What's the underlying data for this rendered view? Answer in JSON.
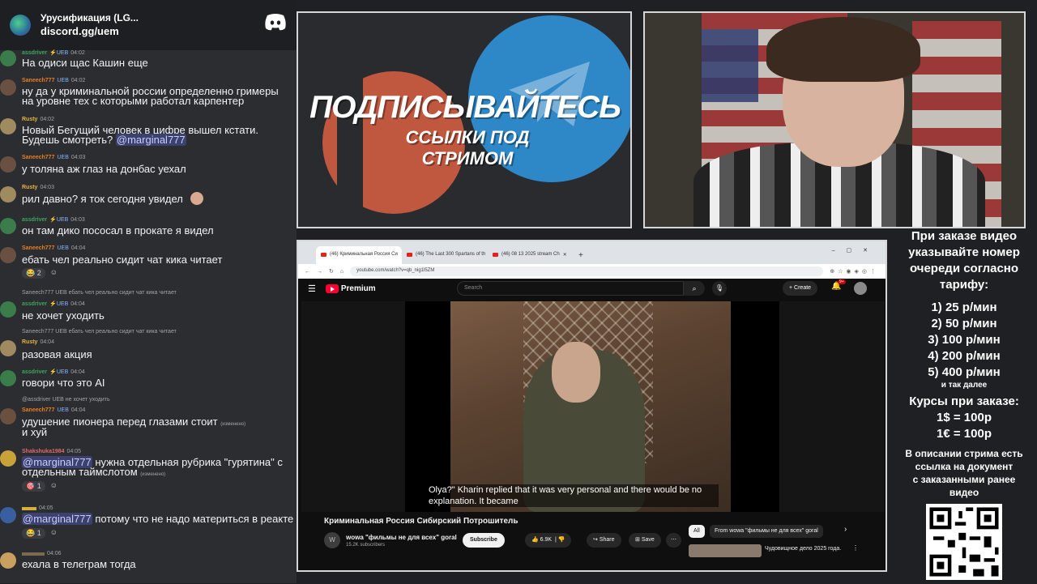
{
  "discord": {
    "server_title": "Урусификация (LG...",
    "server_link": "discord.gg/uem"
  },
  "messages": [
    {
      "user": "assdriver",
      "badge": "⚡UEB",
      "time": "04:02",
      "text": "На одиси щас Кашин еще"
    },
    {
      "user": "Saneech777",
      "badge": "UEB",
      "time": "04:02",
      "text": "ну да у криминальной россии определенно гримеры",
      "text2": "на уровне тех с которыми работал карпентер"
    },
    {
      "user": "Rusty",
      "badge": "",
      "time": "04:02",
      "text": "Новый Бегущий человек в цифре вышел кстати.",
      "text2": "Будешь смотреть?",
      "mention": "@marginal777"
    },
    {
      "user": "Saneech777",
      "badge": "UEB",
      "time": "04:03",
      "text": "у толяна аж глаз на донбас уехал"
    },
    {
      "user": "Rusty",
      "badge": "",
      "time": "04:03",
      "text": "рил давно? я ток сегодня увидел"
    },
    {
      "user": "assdriver",
      "badge": "⚡UEB",
      "time": "04:03",
      "text": "он там дико пососал в прокате я видел"
    },
    {
      "user": "Saneech777",
      "badge": "UEB",
      "time": "04:04",
      "text": "ебать чел реально сидит чат кика читает",
      "reaction": "2"
    },
    {
      "reply": "Saneech777 UEB ебать чел реально сидит чат кика читает",
      "user": "assdriver",
      "badge": "⚡UEB",
      "time": "04:04",
      "text": "не хочет уходить"
    },
    {
      "reply": "Saneech777 UEB ебать чел реально сидит чат кика читает",
      "user": "Rusty",
      "badge": "",
      "time": "04:04",
      "text": "разовая акция"
    },
    {
      "user": "assdriver",
      "badge": "⚡UEB",
      "time": "04:04",
      "text": "говори что это AI"
    },
    {
      "reply": "@assdriver UEB не хочет уходить",
      "user": "Saneech777",
      "badge": "UEB",
      "time": "04:04",
      "text": "удушение пионера перед глазами стоит",
      "edited": "(изменено)",
      "text2": "и хуй"
    },
    {
      "user": "Shakshuka1984",
      "badge": "",
      "time": "04:05",
      "mention": "@marginal777",
      "text": "нужна отдельная рубрика \"гурятина\" с",
      "text2": "отдельным таймслотом",
      "edited2": "(изменено)",
      "reaction": "1"
    },
    {
      "user": "",
      "badge": "",
      "time": "04:05",
      "mention": "@marginal777",
      "text": "потому что не надо материться в реакте",
      "reaction": "1"
    },
    {
      "user": "",
      "badge": "",
      "time": "04:06",
      "text": "ехала в телеграм тогда"
    }
  ],
  "promo": {
    "title": "ПОДПИСЫВАЙТЕСЬ",
    "subtitle": "ССЫЛКИ ПОД СТРИМОМ"
  },
  "browser": {
    "tabs": [
      "(46) Криминальная Россия Си",
      "(46) The Last 300 Spartans of th",
      "(46) 08 13 2025 stream Ch"
    ],
    "url": "youtube.com/watch?v=qb_nig1l5ZM",
    "yt_brand": "Premium",
    "search_placeholder": "Search",
    "create_label": "Create",
    "notif_count": "9+",
    "subtitles": "Olya?\" Kharin replied that it was very personal and there would be no explanation. It became",
    "video_title": "Криминальная Россия Сибирский Потрошитель",
    "channel_initial": "W",
    "channel_name": "wowa \"фильмы не для всех\" goral",
    "channel_subs": "15.2K subscribers",
    "subscribe_label": "Subscribe",
    "likes": "6.9K",
    "share_label": "Share",
    "save_label": "Save",
    "chip_all": "All",
    "chip_from": "From wowa \"фильмы не для всех\" goral",
    "rec_title": "Чудовищное дело 2025 года."
  },
  "info": {
    "line1": "При заказе видео",
    "line2": "указывайте номер",
    "line3": "очереди согласно",
    "line4": "тарифу:",
    "tariffs": [
      "1) 25 р/мин",
      "2) 50 р/мин",
      "3) 100 р/мин",
      "4) 200 р/мин",
      "5) 400 р/мин"
    ],
    "etc": "и так далее",
    "courses_title": "Курсы при заказе:",
    "rate1": "1$ = 100р",
    "rate2": "1€ = 100р",
    "desc1": "В описании стрима есть",
    "desc2": "ссылка на документ",
    "desc3": "с заказанными ранее",
    "desc4": "видео"
  },
  "colors": {
    "assdriver": "#3ba55d",
    "saneech": "#e67e22",
    "rusty": "#e3b341",
    "shakshuka": "#e06a6a",
    "telegram": "#2e88c8",
    "patreon": "#c0583f"
  }
}
